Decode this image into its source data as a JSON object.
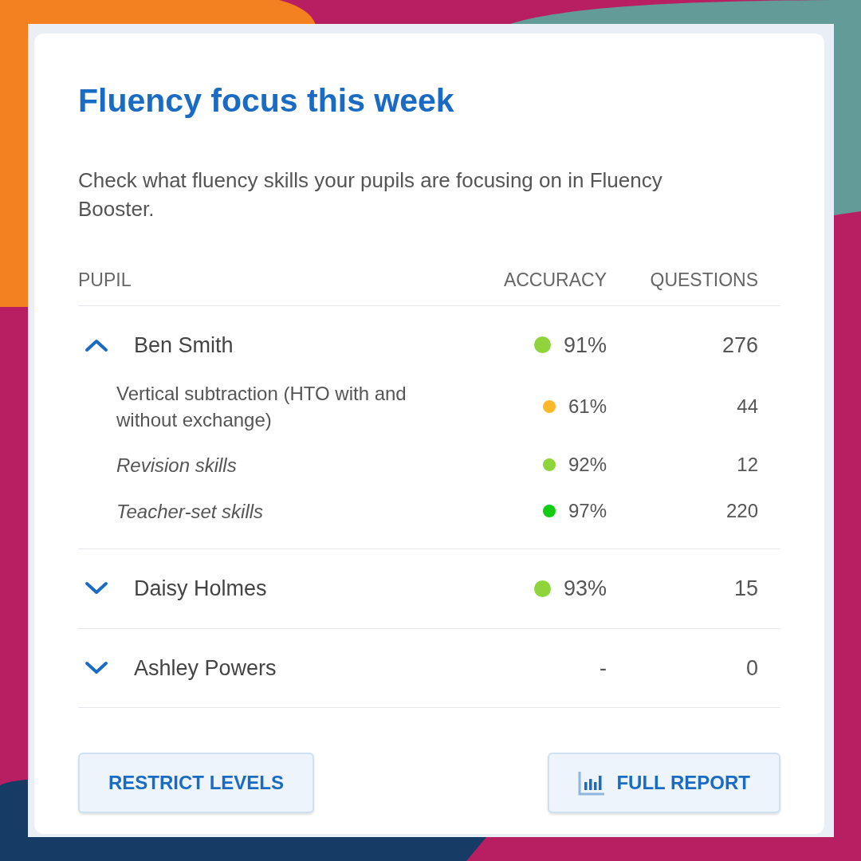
{
  "card": {
    "title": "Fluency focus this week",
    "description": "Check what fluency skills your pupils are focusing on in Fluency Booster."
  },
  "table": {
    "columns": [
      "PUPIL",
      "ACCURACY",
      "QUESTIONS"
    ],
    "rows": [
      {
        "name": "Ben Smith",
        "expanded": true,
        "accuracy": "91%",
        "color": "#8fd43a",
        "questions": "276",
        "children": [
          {
            "name": "Vertical subtraction (HTO with and without exchange)",
            "kind": "skill",
            "accuracy": "61%",
            "color": "#fbb829",
            "questions": "44"
          },
          {
            "name": "Revision skills",
            "kind": "group",
            "accuracy": "92%",
            "color": "#8fd43a",
            "questions": "12"
          },
          {
            "name": "Teacher-set skills",
            "kind": "group",
            "accuracy": "97%",
            "color": "#11cc11",
            "questions": "220"
          }
        ]
      },
      {
        "name": "Daisy Holmes",
        "expanded": false,
        "accuracy": "93%",
        "color": "#8fd43a",
        "questions": "15"
      },
      {
        "name": "Ashley Powers",
        "expanded": false,
        "accuracy": "-",
        "questions": "0"
      }
    ]
  },
  "buttons": [
    {
      "label": "RESTRICT LEVELS",
      "kind": "plain"
    },
    {
      "label": "FULL REPORT",
      "kind": "report"
    }
  ]
}
